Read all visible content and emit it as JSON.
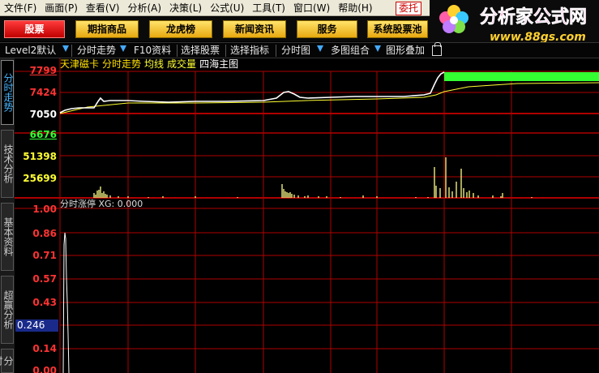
{
  "menu": [
    "文件(F)",
    "画面(P)",
    "查看(V)",
    "分析(A)",
    "决策(L)",
    "公式(U)",
    "工具(T)",
    "窗口(W)",
    "帮助(H)"
  ],
  "entrust_label": "委托",
  "logo": {
    "title": "分析家公式网",
    "url": "www.88gs.com"
  },
  "top_buttons": [
    "股票",
    "期指商品",
    "龙虎榜",
    "新闻资讯",
    "服务",
    "系统股票池"
  ],
  "toolbar": [
    "Level2默认",
    "分时走势",
    "F10资料",
    "选择股票",
    "选择指标",
    "分时图",
    "多图组合",
    "图形叠加"
  ],
  "side_tabs": [
    "分时走势",
    "技术分析",
    "基本资料",
    "超赢分析",
    "分时"
  ],
  "chart_header": {
    "name": "天津磁卡",
    "view": "分时走势",
    "avg": "均线",
    "vol": "成交量",
    "index": "四海主图"
  },
  "sub_header": "分时涨停 XG: 0.000",
  "colors": {
    "up": "#ff3333",
    "down": "#33ff33",
    "grid": "#b00000",
    "price": "#ffffff",
    "avg": "#ffff33",
    "volume": "#ffff88",
    "header_name": "#ffe000",
    "header_view": "#ffe000",
    "header_avg": "#ffff33",
    "header_vol": "#ffff33",
    "header_index": "#ffffff"
  },
  "price_axis": {
    "labels": [
      "7799",
      "7424",
      "7050",
      "6676"
    ],
    "colors": [
      "#ff3333",
      "#ff3333",
      "#ffffff",
      "#33ff33"
    ]
  },
  "volume_axis": {
    "labels": [
      "51398",
      "25699"
    ]
  },
  "indicator_axis": {
    "labels": [
      "1.00",
      "0.86",
      "0.71",
      "0.57",
      "0.43",
      "0.14",
      "0.00"
    ]
  },
  "cursor_value": "0.246"
}
